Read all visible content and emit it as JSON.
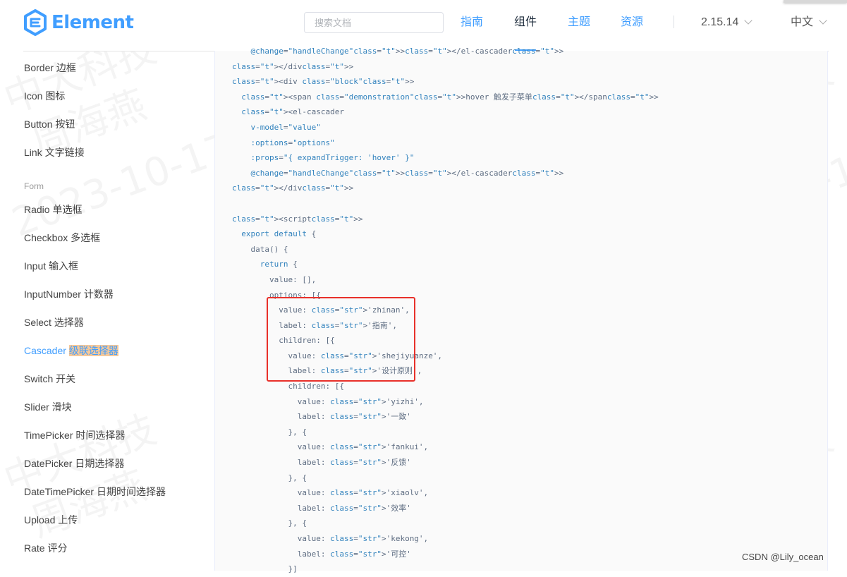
{
  "header": {
    "logo_text": "Element",
    "search_placeholder": "搜索文档",
    "nav": [
      "指南",
      "组件",
      "主题",
      "资源"
    ],
    "active_nav": "组件",
    "version": "2.15.14",
    "language": "中文",
    "accent_color": "#409eff"
  },
  "sidebar": {
    "items_top": [
      "Border 边框",
      "Icon 图标",
      "Button 按钮",
      "Link 文字链接"
    ],
    "group_label": "Form",
    "items_form": [
      "Radio 单选框",
      "Checkbox 多选框",
      "Input 输入框",
      "InputNumber 计数器",
      "Select 选择器",
      "Cascader",
      "Switch 开关",
      "Slider 滑块",
      "TimePicker 时间选择器",
      "DatePicker 日期选择器",
      "DateTimePicker 日期时间选择器",
      "Upload 上传",
      "Rate 评分"
    ],
    "active_item_highlight": "级联选择器"
  },
  "code": [
    "    @change=\"handleChange\"></el-cascader>",
    "</div>",
    "<div class=\"block\">",
    "  <span class=\"demonstration\">hover 触发子菜单</span>",
    "  <el-cascader",
    "    v-model=\"value\"",
    "    :options=\"options\"",
    "    :props=\"{ expandTrigger: 'hover' }\"",
    "    @change=\"handleChange\"></el-cascader>",
    "</div>",
    "",
    "<script>",
    "  export default {",
    "    data() {",
    "      return {",
    "        value: [],",
    "        options: [{",
    "          value: 'zhinan',",
    "          label: '指南',",
    "          children: [{",
    "            value: 'shejiyuanze',",
    "            label: '设计原则',",
    "            children: [{",
    "              value: 'yizhi',",
    "              label: '一致'",
    "            }, {",
    "              value: 'fankui',",
    "              label: '反馈'",
    "            }, {",
    "              value: 'xiaolv',",
    "              label: '效率'",
    "            }, {",
    "              value: 'kekong',",
    "              label: '可控'",
    "            }]"
  ],
  "watermark": {
    "line1": "中大科技",
    "line2": "周海燕",
    "line3": "2023-10-17"
  },
  "credit": "CSDN @Lily_ocean"
}
